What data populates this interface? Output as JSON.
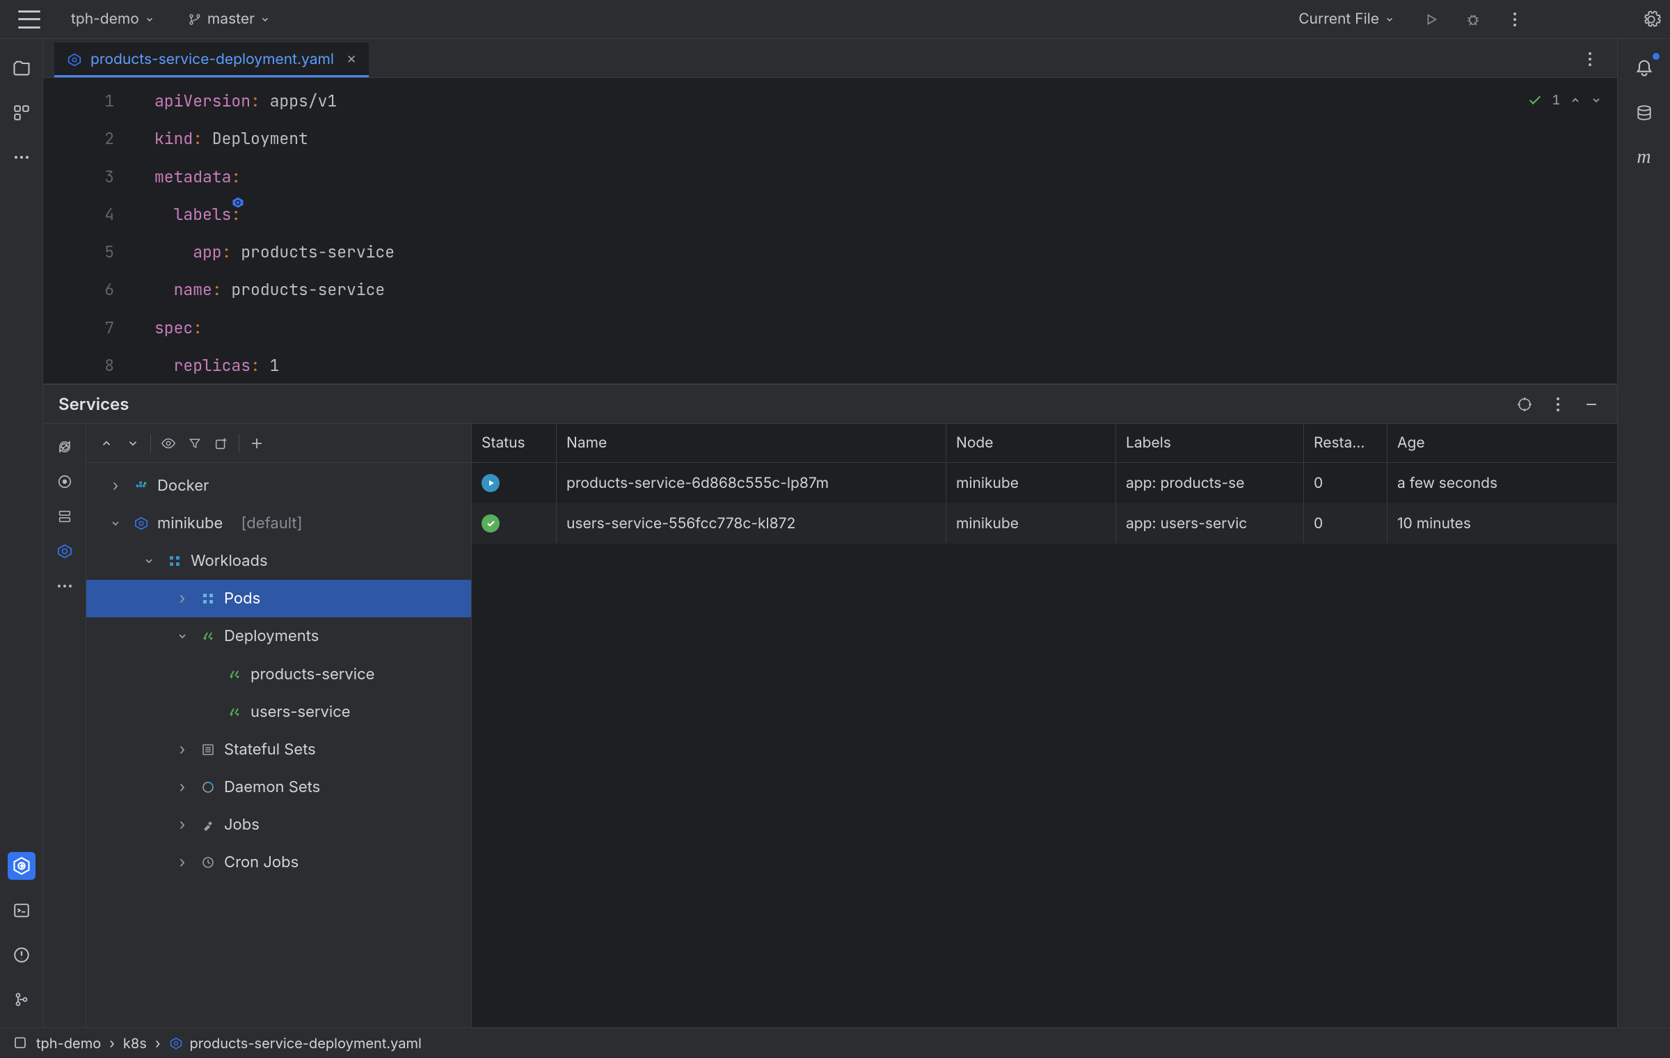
{
  "header": {
    "project": "tph-demo",
    "branch": "master",
    "runConfig": "Current File"
  },
  "editor": {
    "fileName": "products-service-deployment.yaml",
    "problemsCount": "1",
    "lines": [
      {
        "n": 1,
        "key": "apiVersion",
        "colon": ":",
        "val": " apps/v1",
        "indent": 0
      },
      {
        "n": 2,
        "key": "kind",
        "colon": ":",
        "val": " Deployment",
        "indent": 0
      },
      {
        "n": 3,
        "key": "metadata",
        "colon": ":",
        "val": "",
        "indent": 0
      },
      {
        "n": 4,
        "key": "labels",
        "colon": ":",
        "val": "",
        "indent": 1,
        "icon": true
      },
      {
        "n": 5,
        "key": "app",
        "colon": ":",
        "val": " products-service",
        "indent": 2
      },
      {
        "n": 6,
        "key": "name",
        "colon": ":",
        "val": " products-service",
        "indent": 1
      },
      {
        "n": 7,
        "key": "spec",
        "colon": ":",
        "val": "",
        "indent": 0
      },
      {
        "n": 8,
        "key": "replicas",
        "colon": ":",
        "val": " 1",
        "indent": 1
      }
    ]
  },
  "services": {
    "title": "Services",
    "tree": {
      "docker": "Docker",
      "cluster": "minikube",
      "clusterDefault": "[default]",
      "workloads": "Workloads",
      "pods": "Pods",
      "deployments": "Deployments",
      "depl": [
        "products-service",
        "users-service"
      ],
      "stateful": "Stateful Sets",
      "daemon": "Daemon Sets",
      "jobs": "Jobs",
      "cron": "Cron Jobs"
    },
    "table": {
      "headers": {
        "status": "Status",
        "name": "Name",
        "node": "Node",
        "labels": "Labels",
        "restarts": "Resta…",
        "age": "Age"
      },
      "rows": [
        {
          "status": "running",
          "name": "products-service-6d868c555c-lp87m",
          "node": "minikube",
          "labels": "app: products-se",
          "restarts": "0",
          "age": "a few seconds"
        },
        {
          "status": "ready",
          "name": "users-service-556fcc778c-kl872",
          "node": "minikube",
          "labels": "app: users-servic",
          "restarts": "0",
          "age": "10 minutes"
        }
      ]
    }
  },
  "breadcrumbs": [
    "tph-demo",
    "k8s",
    "products-service-deployment.yaml"
  ]
}
